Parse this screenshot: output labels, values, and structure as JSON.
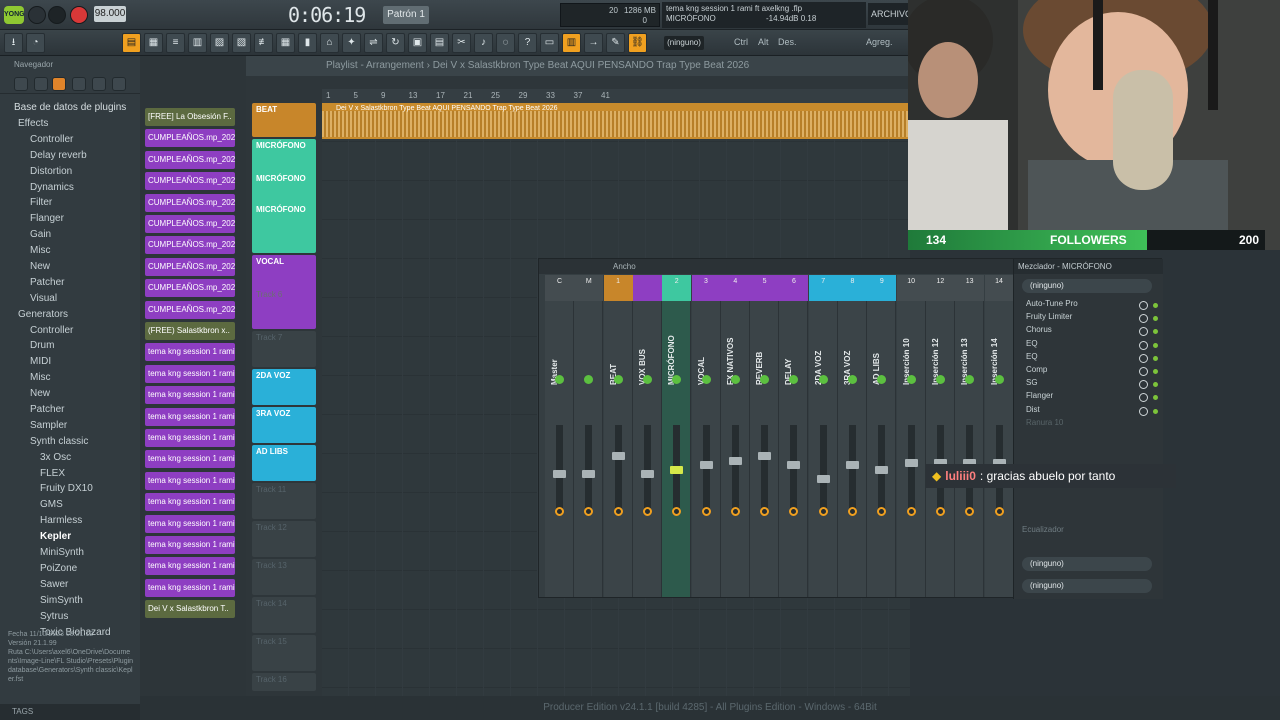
{
  "app": {
    "logo": "YONG",
    "tempo": "98.000",
    "time": "0:06:19",
    "pattern": "Patrón 1",
    "cpu_label": "20",
    "mem": "1286 MB",
    "mem2": "0",
    "hint_line1": "tema kng session 1 rami ft axelkng .flp",
    "hint_line2": "MICRÓFONO",
    "hint_db": "-14.94dB",
    "hint_val": "0.18",
    "archivo": "ARCHIVO (",
    "status": "Producer Edition v24.1.1 [build 4285] - All Plugins Edition - Windows - 64Bit"
  },
  "toolbar": {
    "ninguno": "(ninguno)",
    "items": [
      "Ctrl",
      "Alt",
      "Des.",
      "Agreg."
    ]
  },
  "browser": {
    "header": "Navegador",
    "root": "Base de datos de plugins",
    "items": [
      {
        "label": "Effects",
        "lvl": 1
      },
      {
        "label": "Controller",
        "lvl": 2
      },
      {
        "label": "Delay reverb",
        "lvl": 2
      },
      {
        "label": "Distortion",
        "lvl": 2
      },
      {
        "label": "Dynamics",
        "lvl": 2
      },
      {
        "label": "Filter",
        "lvl": 2
      },
      {
        "label": "Flanger",
        "lvl": 2
      },
      {
        "label": "Gain",
        "lvl": 2
      },
      {
        "label": "Misc",
        "lvl": 2
      },
      {
        "label": "New",
        "lvl": 2
      },
      {
        "label": "Patcher",
        "lvl": 2
      },
      {
        "label": "Visual",
        "lvl": 2
      },
      {
        "label": "Generators",
        "lvl": 1
      },
      {
        "label": "Controller",
        "lvl": 2
      },
      {
        "label": "Drum",
        "lvl": 2
      },
      {
        "label": "MIDI",
        "lvl": 2
      },
      {
        "label": "Misc",
        "lvl": 2
      },
      {
        "label": "New",
        "lvl": 2
      },
      {
        "label": "Patcher",
        "lvl": 2
      },
      {
        "label": "Sampler",
        "lvl": 2
      },
      {
        "label": "Synth classic",
        "lvl": 2
      },
      {
        "label": "3x Osc",
        "lvl": 3
      },
      {
        "label": "FLEX",
        "lvl": 3
      },
      {
        "label": "Fruity DX10",
        "lvl": 3
      },
      {
        "label": "GMS",
        "lvl": 3
      },
      {
        "label": "Harmless",
        "lvl": 3
      },
      {
        "label": "Kepler",
        "lvl": 3
      },
      {
        "label": "MiniSynth",
        "lvl": 3
      },
      {
        "label": "PoiZone",
        "lvl": 3
      },
      {
        "label": "Sawer",
        "lvl": 3
      },
      {
        "label": "SimSynth",
        "lvl": 3
      },
      {
        "label": "Sytrus",
        "lvl": 3
      },
      {
        "label": "Toxic Biohazard",
        "lvl": 3
      }
    ],
    "info_fecha_label": "Fecha",
    "info_fecha": "11/10/2023 08:21:12",
    "info_version_label": "Versión",
    "info_version": "21.1.99",
    "info_ruta_label": "Ruta",
    "info_ruta": "C:\\Users\\axel6\\OneDrive\\Documents\\Image-Line\\FL Studio\\Presets\\Plugin database\\Generators\\Synth classic\\Kepler.fst",
    "tags": "TAGS"
  },
  "clips": [
    {
      "label": "[FREE] La Obsesión F..",
      "t": "alt"
    },
    {
      "label": "CUMPLEAÑOS.mp_2026-0..",
      "t": "p"
    },
    {
      "label": "CUMPLEAÑOS.mp_2026-0..",
      "t": "p"
    },
    {
      "label": "CUMPLEAÑOS.mp_2026-0..",
      "t": "p"
    },
    {
      "label": "CUMPLEAÑOS.mp_2026-0..",
      "t": "p"
    },
    {
      "label": "CUMPLEAÑOS.mp_2026-0..",
      "t": "p"
    },
    {
      "label": "CUMPLEAÑOS.mp_2026-0..",
      "t": "p"
    },
    {
      "label": "CUMPLEAÑOS.mp_2026-0..",
      "t": "p"
    },
    {
      "label": "CUMPLEAÑOS.mp_2026-0..",
      "t": "p"
    },
    {
      "label": "CUMPLEAÑOS.mp_2026-0..",
      "t": "p"
    },
    {
      "label": "(FREE) Salastkbron x..",
      "t": "alt"
    },
    {
      "label": "tema kng session 1 rami..",
      "t": "p"
    },
    {
      "label": "tema kng session 1 rami..",
      "t": "p"
    },
    {
      "label": "tema kng session 1 rami..",
      "t": "p"
    },
    {
      "label": "tema kng session 1 rami..",
      "t": "p"
    },
    {
      "label": "tema kng session 1 rami..",
      "t": "p"
    },
    {
      "label": "tema kng session 1 rami..",
      "t": "p"
    },
    {
      "label": "tema kng session 1 rami..",
      "t": "p"
    },
    {
      "label": "tema kng session 1 rami..",
      "t": "p"
    },
    {
      "label": "tema kng session 1 rami..",
      "t": "p"
    },
    {
      "label": "tema kng session 1 rami..",
      "t": "p"
    },
    {
      "label": "tema kng session 1 rami..",
      "t": "p"
    },
    {
      "label": "tema kng session 1 rami..",
      "t": "p"
    },
    {
      "label": "Dei V x Salastkbron T..",
      "t": "alt"
    }
  ],
  "playlist": {
    "title": "Playlist - Arrangement",
    "breadcrumb": "Dei V x Salastkbron Type Beat  AQUI PENSANDO  Trap Type Beat 2026",
    "ruler": [
      "1",
      "5",
      "9",
      "13",
      "17",
      "21",
      "25",
      "29",
      "33",
      "37",
      "41"
    ],
    "beat_clip": "Dei V x Salastkbron Type Beat  AQUI PENSANDO  Trap Type Beat 2026",
    "tracks": [
      {
        "label": "BEAT",
        "color": "#c8862a",
        "h": 36
      },
      {
        "label": "MICRÓFONO",
        "color": "#3ec8a0",
        "h": 116,
        "sub": [
          "MICRÓFONO",
          "MICRÓFONO"
        ]
      },
      {
        "label": "VOCAL",
        "color": "#8e3ec2",
        "h": 76,
        "sub": [
          "Track 6"
        ]
      },
      {
        "label": "Track 7",
        "color": "",
        "h": 38
      },
      {
        "label": "2DA VOZ",
        "color": "#2ab0d8",
        "h": 38
      },
      {
        "label": "3RA VOZ",
        "color": "#2ab0d8",
        "h": 38
      },
      {
        "label": "AD LIBS",
        "color": "#2ab0d8",
        "h": 38
      },
      {
        "label": "Track 11",
        "color": "",
        "h": 38
      },
      {
        "label": "Track 12",
        "color": "",
        "h": 38
      },
      {
        "label": "Track 13",
        "color": "",
        "h": 38
      },
      {
        "label": "Track 14",
        "color": "",
        "h": 38
      },
      {
        "label": "Track 15",
        "color": "",
        "h": 38
      },
      {
        "label": "Track 16",
        "color": "",
        "h": 20
      }
    ]
  },
  "webcam": {
    "followers_count": "134",
    "followers_label": "FOLLOWERS",
    "followers_goal": "200",
    "progress": 0.67
  },
  "mixer": {
    "title_left": "Ancho",
    "title_right": "Mezclador - MICRÓFONO",
    "strips": [
      {
        "num": "C",
        "name": "Master",
        "color": "#444c50"
      },
      {
        "num": "M",
        "name": "",
        "color": "#444c50"
      },
      {
        "num": "1",
        "name": "BEAT",
        "color": "#c8862a"
      },
      {
        "num": "",
        "name": "VOX BUS",
        "color": "#8e3ec2"
      },
      {
        "num": "2",
        "name": "MICRÓFONO",
        "color": "#3ec8a0"
      },
      {
        "num": "3",
        "name": "VOCAL",
        "color": "#8e3ec2"
      },
      {
        "num": "4",
        "name": "FX NATIVOS",
        "color": "#8e3ec2"
      },
      {
        "num": "5",
        "name": "REVERB",
        "color": "#8e3ec2"
      },
      {
        "num": "6",
        "name": "DELAY",
        "color": "#8e3ec2"
      },
      {
        "num": "7",
        "name": "2DA VOZ",
        "color": "#2ab0d8"
      },
      {
        "num": "8",
        "name": "3RA VOZ",
        "color": "#2ab0d8"
      },
      {
        "num": "9",
        "name": "AD LIBS",
        "color": "#2ab0d8"
      },
      {
        "num": "10",
        "name": "Inserción 10",
        "color": "#444c50"
      },
      {
        "num": "12",
        "name": "Inserción 12",
        "color": "#444c50"
      },
      {
        "num": "13",
        "name": "Inserción 13",
        "color": "#444c50"
      },
      {
        "num": "14",
        "name": "Inserción 14",
        "color": "#444c50"
      }
    ],
    "input": "(ninguno)",
    "slots": [
      "Auto-Tune Pro",
      "Fruity Limiter",
      "Chorus",
      "EQ",
      "EQ",
      "Comp",
      "SG",
      "Flanger",
      "Dist",
      "Ranura 10"
    ],
    "eq_label": "Ecualizador",
    "out1": "(ninguno)",
    "out2": "(ninguno)"
  },
  "chat": {
    "user": "luliii0",
    "message": ": gracias abuelo por tanto"
  }
}
